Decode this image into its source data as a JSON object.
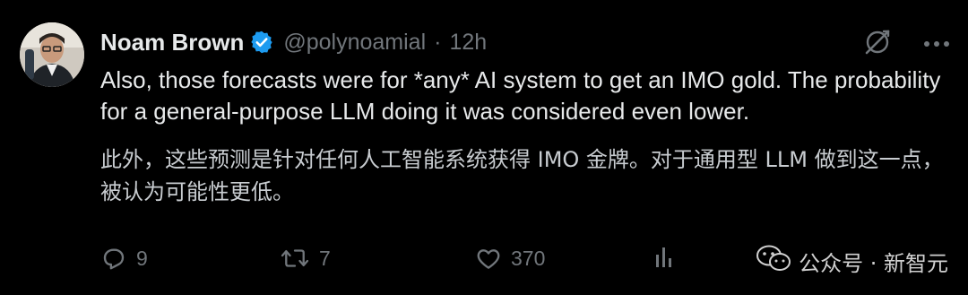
{
  "tweet": {
    "author_name": "Noam Brown",
    "handle": "@polynoamial",
    "separator": "·",
    "time": "12h",
    "text": "Also, those forecasts were for *any* AI system to get an IMO gold. The probability for a general-purpose LLM doing it was considered even lower.",
    "translation": "此外，这些预测是针对任何人工智能系统获得 IMO 金牌。对于通用型 LLM 做到这一点，被认为可能性更低。"
  },
  "actions": {
    "replies": "9",
    "reposts": "7",
    "likes": "370"
  },
  "watermark": {
    "text": "公众号 · 新智元"
  },
  "icons": {
    "verified": "verified-badge-icon",
    "grok": "grok-icon",
    "more": "more-icon",
    "reply": "reply-icon",
    "repost": "repost-icon",
    "like": "heart-icon",
    "views": "views-icon",
    "wechat": "wechat-icon"
  },
  "colors": {
    "background": "#000000",
    "text": "#e7e9ea",
    "secondary": "#71767b",
    "verified": "#1d9bf0"
  }
}
